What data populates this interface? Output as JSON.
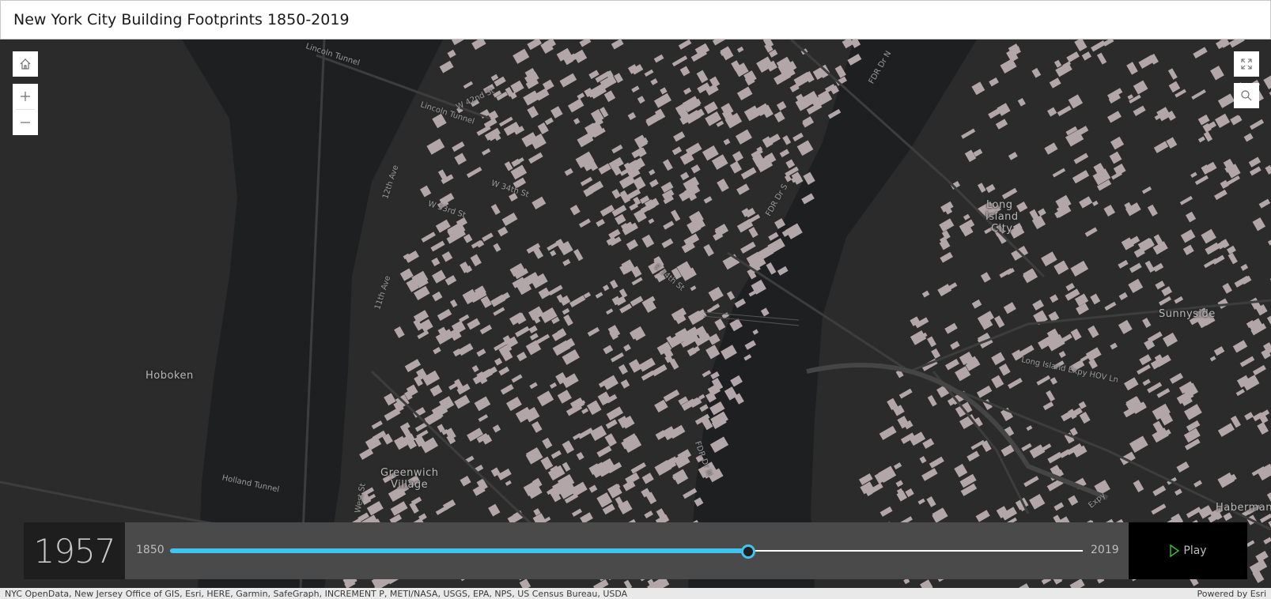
{
  "header": {
    "title": "New York City Building Footprints 1850-2019"
  },
  "map": {
    "labels": {
      "hoboken": "Hoboken",
      "greenwich_1": "Greenwich",
      "greenwich_2": "Village",
      "lic_1": "Long",
      "lic_2": "Island",
      "lic_3": "City",
      "sunnyside": "Sunnyside",
      "habermann": "Haberman"
    },
    "streets": {
      "lincoln_tunnel_1": "Lincoln Tunnel",
      "lincoln_tunnel_2": "Lincoln Tunnel",
      "w42": "W 42nd St",
      "w34": "W 34th St",
      "w33": "W 33rd St",
      "ave12": "12th Ave",
      "ave11": "11th Ave",
      "fdr_1": "FDR Dr N",
      "fdr_2": "FDR Dr S",
      "fdr_3": "FDR Dr N",
      "e34": "E 34th St",
      "holland": "Holland Tunnel",
      "lie": "Long Island Expy HOV Ln",
      "west_st": "West St",
      "expy": "Expy"
    },
    "colors": {
      "water": "#1d1f21",
      "land": "#2b2b2b",
      "buildings": "#b3a6a8",
      "roads": "#3a3a3a"
    }
  },
  "controls": {
    "home_icon": "home-icon",
    "zoom_in_icon": "plus-icon",
    "zoom_out_icon": "minus-icon",
    "fullscreen_icon": "expand-icon",
    "search_icon": "search-icon"
  },
  "time_slider": {
    "current_year": "1957",
    "min_label": "1850",
    "max_label": "2019",
    "min": 1850,
    "max": 2019,
    "value": 1957,
    "play_label": "Play",
    "accent_color": "#40c3ee",
    "play_icon_color": "#35c435"
  },
  "attribution": {
    "sources": "NYC OpenData, New Jersey Office of GIS, Esri, HERE, Garmin, SafeGraph, INCREMENT P, METI/NASA, USGS, EPA, NPS, US Census Bureau, USDA",
    "powered_by": "Powered by Esri"
  }
}
